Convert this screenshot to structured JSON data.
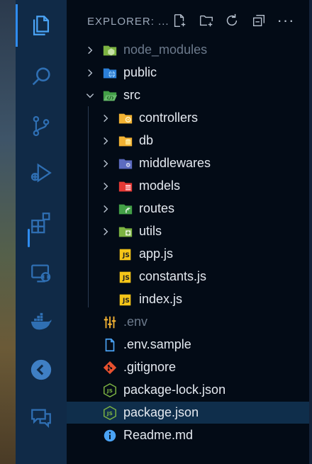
{
  "sidebar": {
    "title": "EXPLORER: ...",
    "actions": {
      "new_file": "new-file-icon",
      "new_folder": "new-folder-icon",
      "refresh": "refresh-icon",
      "collapse": "collapse-all-icon",
      "more": "···"
    }
  },
  "tree": {
    "items": [
      {
        "label": "node_modules"
      },
      {
        "label": "public"
      },
      {
        "label": "src"
      },
      {
        "label": "controllers"
      },
      {
        "label": "db"
      },
      {
        "label": "middlewares"
      },
      {
        "label": "models"
      },
      {
        "label": "routes"
      },
      {
        "label": "utils"
      },
      {
        "label": "app.js"
      },
      {
        "label": "constants.js"
      },
      {
        "label": "index.js"
      },
      {
        "label": ".env"
      },
      {
        "label": ".env.sample"
      },
      {
        "label": ".gitignore"
      },
      {
        "label": "package-lock.json"
      },
      {
        "label": "package.json"
      },
      {
        "label": "Readme.md"
      }
    ],
    "selected": "package.json",
    "js_badge": "JS"
  },
  "colors": {
    "activity_bg": "#102a47",
    "sidebar_bg": "#030b16",
    "accent": "#2f8cf0",
    "selected_row": "#0f2e4b",
    "folder_yellow": "#f2b233",
    "js_yellow": "#f5c518"
  }
}
